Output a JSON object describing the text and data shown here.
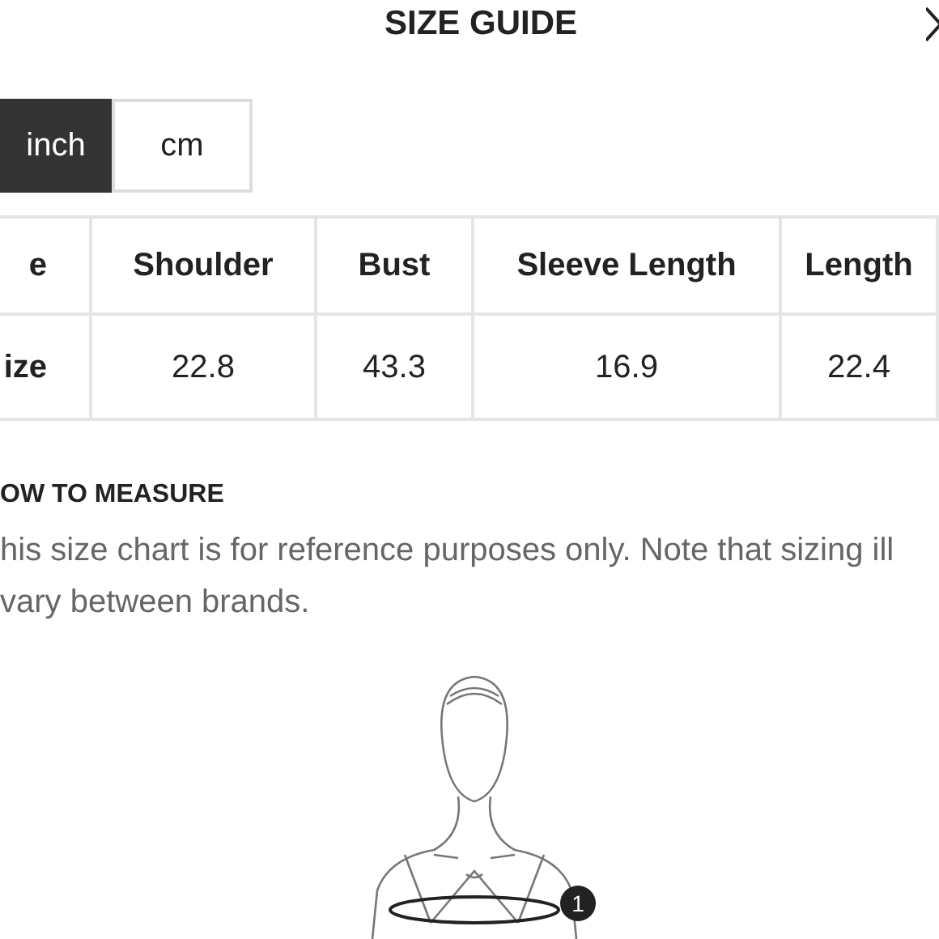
{
  "title": "SIZE GUIDE",
  "units": [
    {
      "label": "inch",
      "selected": true
    },
    {
      "label": "cm",
      "selected": false
    }
  ],
  "table": {
    "columns": [
      "e",
      "Shoulder",
      "Bust",
      "Sleeve Length",
      "Length"
    ],
    "rows": [
      [
        "ize",
        "22.8",
        "43.3",
        "16.9",
        "22.4"
      ]
    ]
  },
  "how_to_measure": {
    "heading": "OW TO MEASURE",
    "text": "his size chart is for reference purposes only. Note that sizing ill vary between brands."
  },
  "figure": {
    "marker": "1"
  }
}
